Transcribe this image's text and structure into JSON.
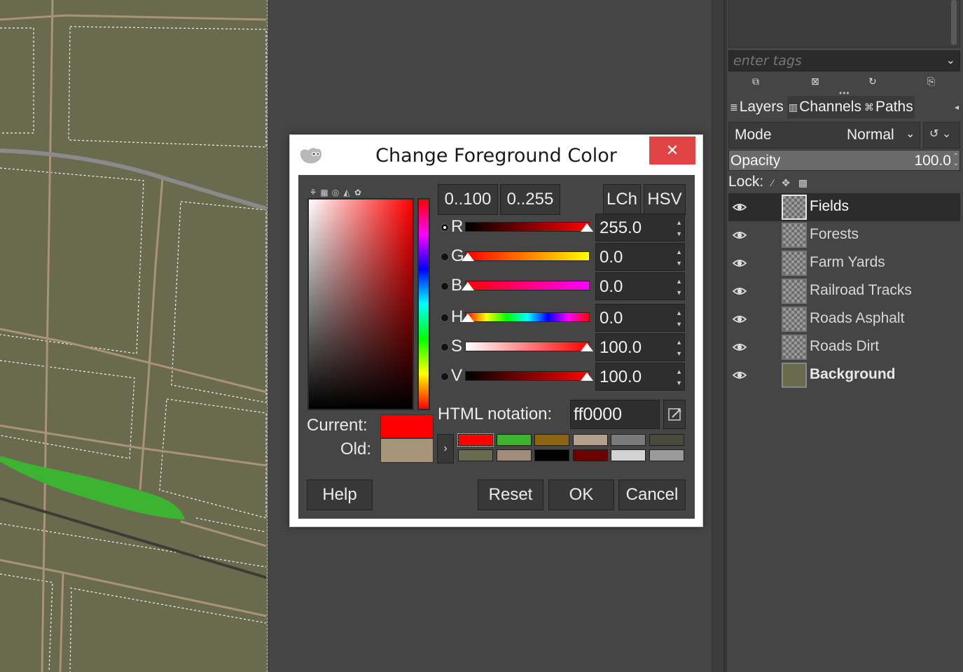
{
  "dialog": {
    "title": "Change Foreground Color",
    "close_label": "✕",
    "range_100": "0..100",
    "range_255": "0..255",
    "lch_label": "LCh",
    "hsv_label": "HSV",
    "current_label": "Current:",
    "old_label": "Old:",
    "current_color": "#ff0000",
    "old_color": "#a89478",
    "html_label": "HTML notation:",
    "html_value": "ff0000",
    "history_arrow": "›",
    "buttons": {
      "help": "Help",
      "reset": "Reset",
      "ok": "OK",
      "cancel": "Cancel"
    },
    "sliders": [
      {
        "ch": "R",
        "value": "255.0",
        "level": 1.0,
        "selected": true
      },
      {
        "ch": "G",
        "value": "0.0",
        "level": 0.0,
        "selected": false
      },
      {
        "ch": "B",
        "value": "0.0",
        "level": 0.0,
        "selected": false
      },
      {
        "ch": "H",
        "value": "0.0",
        "level": 0.0,
        "selected": false
      },
      {
        "ch": "S",
        "value": "100.0",
        "level": 1.0,
        "selected": false
      },
      {
        "ch": "V",
        "value": "100.0",
        "level": 1.0,
        "selected": false
      }
    ],
    "history_colors": [
      "#ff0000",
      "#3cb432",
      "#8c6414",
      "#b4a08c",
      "#7a7a7a",
      "#4a4a3c",
      "#6a6a4e",
      "#a08c78",
      "#000000",
      "#6e0000",
      "#d2d2d2",
      "#9a9a9a"
    ]
  },
  "dock": {
    "tag_placeholder": "enter tags",
    "tabs": {
      "layers": "Layers",
      "channels": "Channels",
      "paths": "Paths"
    },
    "mode_label": "Mode",
    "mode_value": "Normal",
    "opacity_label": "Opacity",
    "opacity_value": "100.0",
    "lock_label": "Lock:",
    "layers": [
      {
        "name": "Fields",
        "selected": true,
        "bold": false,
        "solid": false
      },
      {
        "name": "Forests",
        "selected": false,
        "bold": false,
        "solid": false
      },
      {
        "name": "Farm Yards",
        "selected": false,
        "bold": false,
        "solid": false
      },
      {
        "name": "Railroad Tracks",
        "selected": false,
        "bold": false,
        "solid": false
      },
      {
        "name": "Roads Asphalt",
        "selected": false,
        "bold": false,
        "solid": false
      },
      {
        "name": "Roads Dirt",
        "selected": false,
        "bold": false,
        "solid": false
      },
      {
        "name": "Background",
        "selected": false,
        "bold": true,
        "solid": true
      }
    ]
  },
  "colors": {
    "canvas_bg": "#6a6a4e",
    "road_dirt": "#a89478",
    "road_asphalt": "#8a8a8a",
    "forest": "#3cb432",
    "railroad": "#3c3c34"
  }
}
